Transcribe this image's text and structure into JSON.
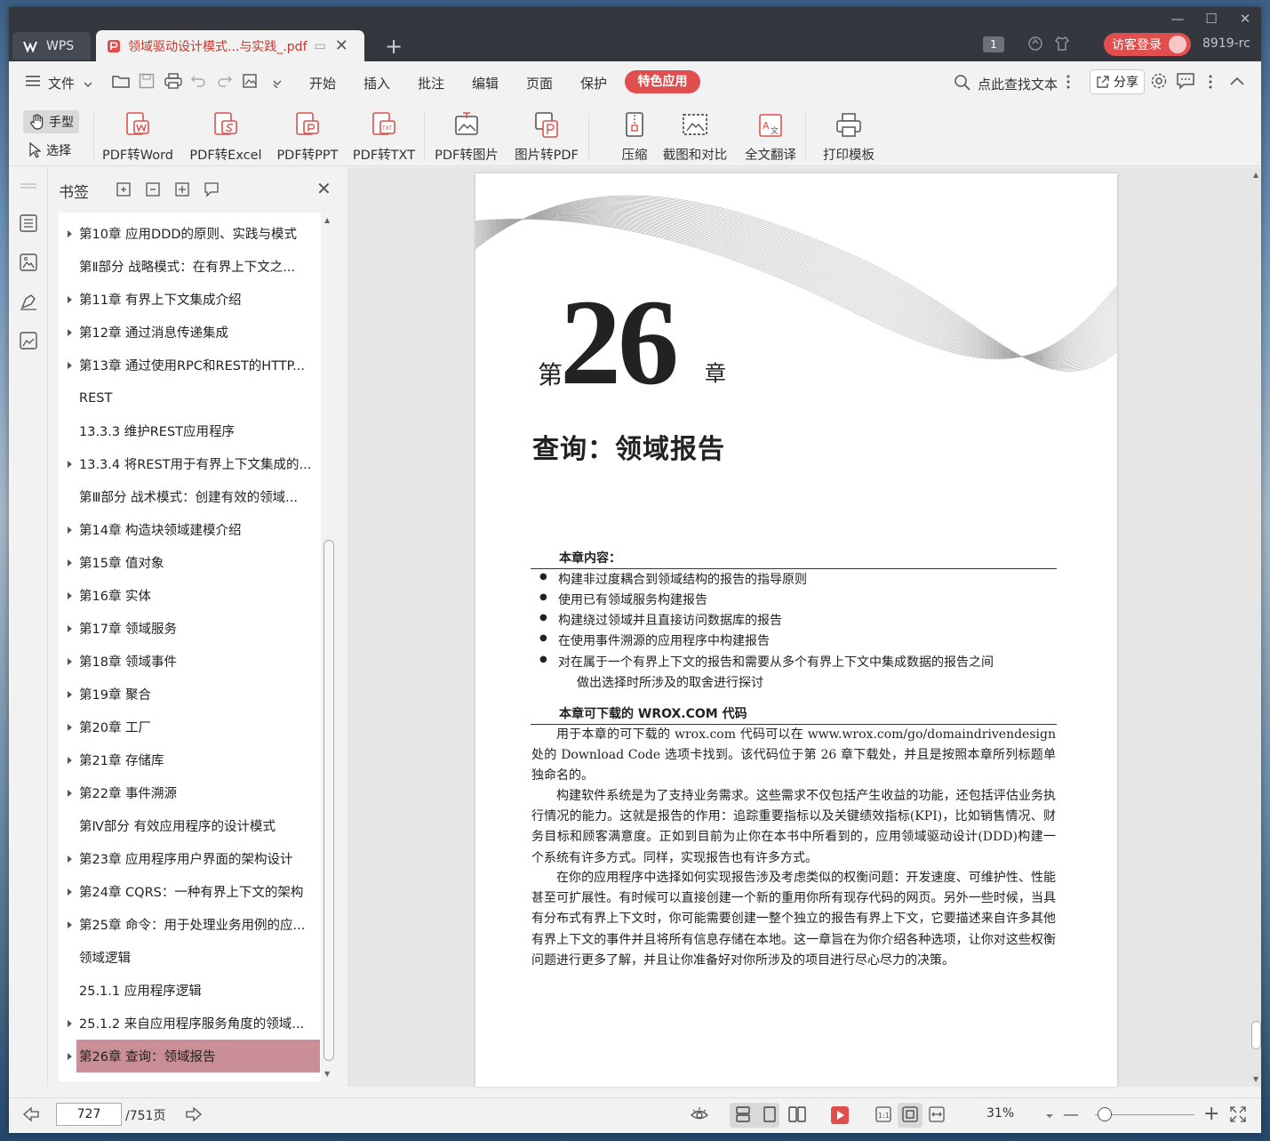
{
  "window": {
    "app_tab": "WPS",
    "doc_tab": "领域驱动设计模式...与实践_.pdf",
    "tab_count": "1",
    "login_label": "访客登录",
    "user_id": "8919-rc"
  },
  "menu": {
    "file": "文件",
    "items": [
      "开始",
      "插入",
      "批注",
      "编辑",
      "页面",
      "保护"
    ],
    "special": "特色应用",
    "search_placeholder": "点此查找文本",
    "share": "分享"
  },
  "toolbar": {
    "hand": "手型",
    "select": "选择",
    "tools": [
      "PDF转Word",
      "PDF转Excel",
      "PDF转PPT",
      "PDF转TXT",
      "PDF转图片",
      "图片转PDF",
      "压缩",
      "截图和对比",
      "全文翻译",
      "打印模板"
    ]
  },
  "bookmarks": {
    "title": "书签",
    "items": [
      {
        "label": "第10章 应用DDD的原则、实践与模式",
        "expandable": true
      },
      {
        "label": "第Ⅱ部分 战略模式：在有界上下文之...",
        "expandable": false
      },
      {
        "label": "第11章 有界上下文集成介绍",
        "expandable": true
      },
      {
        "label": "第12章 通过消息传递集成",
        "expandable": true
      },
      {
        "label": "第13章 通过使用RPC和REST的HTTP...",
        "expandable": true
      },
      {
        "label": "REST",
        "expandable": false
      },
      {
        "label": "13.3.3 维护REST应用程序",
        "expandable": false
      },
      {
        "label": "13.3.4 将REST用于有界上下文集成的...",
        "expandable": true
      },
      {
        "label": "第Ⅲ部分 战术模式：创建有效的领域...",
        "expandable": false
      },
      {
        "label": "第14章 构造块领域建模介绍",
        "expandable": true
      },
      {
        "label": "第15章 值对象",
        "expandable": true
      },
      {
        "label": "第16章 实体",
        "expandable": true
      },
      {
        "label": "第17章 领域服务",
        "expandable": true
      },
      {
        "label": "第18章 领域事件",
        "expandable": true
      },
      {
        "label": "第19章 聚合",
        "expandable": true
      },
      {
        "label": "第20章 工厂",
        "expandable": true
      },
      {
        "label": "第21章 存储库",
        "expandable": true
      },
      {
        "label": "第22章 事件溯源",
        "expandable": true
      },
      {
        "label": "第Ⅳ部分 有效应用程序的设计模式",
        "expandable": false
      },
      {
        "label": "第23章 应用程序用户界面的架构设计",
        "expandable": true
      },
      {
        "label": "第24章 CQRS：一种有界上下文的架构",
        "expandable": true
      },
      {
        "label": "第25章 命令：用于处理业务用例的应...",
        "expandable": true
      },
      {
        "label": "领域逻辑",
        "expandable": false
      },
      {
        "label": "25.1.1 应用程序逻辑",
        "expandable": false
      },
      {
        "label": "25.1.2 来自应用程序服务角度的领域...",
        "expandable": true
      },
      {
        "label": "第26章 查询：领域报告",
        "expandable": true,
        "active": true
      }
    ]
  },
  "document": {
    "chapter_prefix": "第",
    "chapter_number": "26",
    "chapter_suffix": "章",
    "chapter_title": "查询：领域报告",
    "contents_heading": "本章内容：",
    "bullets": [
      "构建非过度耦合到领域结构的报告的指导原则",
      "使用已有领域服务构建报告",
      "构建绕过领域并且直接访问数据库的报告",
      "在使用事件溯源的应用程序中构建报告",
      "对在属于一个有界上下文的报告和需要从多个有界上下文中集成数据的报告之间",
      "做出选择时所涉及的取舍进行探讨"
    ],
    "download_heading": "本章可下载的 WROX.COM 代码",
    "paragraphs": [
      "用于本章的可下载的 wrox.com 代码可以在 www.wrox.com/go/domaindrivendesign 处的 Download Code 选项卡找到。该代码位于第 26 章下载处，并且是按照本章所列标题单独命名的。",
      "构建软件系统是为了支持业务需求。这些需求不仅包括产生收益的功能，还包括评估业务执行情况的能力。这就是报告的作用：追踪重要指标以及关键绩效指标(KPI)，比如销售情况、财务目标和顾客满意度。正如到目前为止你在本书中所看到的，应用领域驱动设计(DDD)构建一个系统有许多方式。同样，实现报告也有许多方式。",
      "在你的应用程序中选择如何实现报告涉及考虑类似的权衡问题：开发速度、可维护性、性能甚至可扩展性。有时候可以直接创建一个新的重用你所有现存代码的网页。另外一些时候，当具有分布式有界上下文时，你可能需要创建一整个独立的报告有界上下文，它要描述来自许多其他有界上下文的事件并且将所有信息存储在本地。这一章旨在为你介绍各种选项，让你对这些权衡问题进行更多了解，并且让你准备好对你所涉及的项目进行尽心尽力的决策。"
    ]
  },
  "status": {
    "current_page": "727",
    "total_pages": "/751页",
    "zoom": "31%"
  },
  "colors": {
    "accent": "#e04e4e",
    "active_bookmark": "#c98e96",
    "titlebar": "#34373e"
  }
}
